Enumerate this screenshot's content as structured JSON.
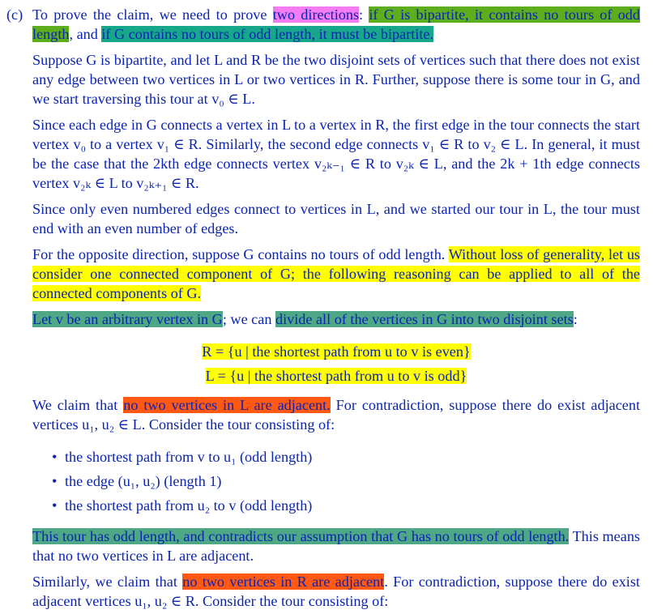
{
  "section_label": "(c)",
  "para1": {
    "t1": "To prove the claim, we need to prove ",
    "h1": "two directions",
    "t2": ": ",
    "h2": "if G is bipartite, it contains no tours of odd length",
    "t3": ", and ",
    "h3": "if G contains no tours of odd length, it must be bipartite."
  },
  "para2": "Suppose G is bipartite, and let L and R be the two disjoint sets of vertices such that there does not exist any edge between two vertices in L or two vertices in R. Further, suppose there is some tour in G, and we start traversing this tour at v₀ ∈ L.",
  "para3": "Since each edge in G connects a vertex in L to a vertex in R, the first edge in the tour connects the start vertex v₀ to a vertex v₁ ∈ R. Similarly, the second edge connects v₁ ∈ R to v₂ ∈ L. In general, it must be the case that the 2kth edge connects vertex v₂ₖ₋₁ ∈ R to v₂ₖ ∈ L, and the 2k + 1th edge connects vertex v₂ₖ ∈ L to v₂ₖ₊₁ ∈ R.",
  "para4": "Since only even numbered edges connect to vertices in L, and we started our tour in L, the tour must end with an even number of edges.",
  "para5": {
    "t1": "For the opposite direction, suppose G contains no tours of odd length. ",
    "h1": "Without loss of generality, let us consider one connected component of G; the following reasoning can be applied to all of the connected components of G."
  },
  "para6": {
    "h1": "Let v be an arbitrary vertex in G",
    "t1": "; we can ",
    "h2": "divide all of the vertices in G into two disjoint sets",
    "t2": ":"
  },
  "eq1": {
    "lhs": "R = {u | ",
    "h": "the shortest path from u to v is even",
    "rhs": "}"
  },
  "eq2": {
    "lhs": "L = {u | ",
    "h": "the shortest path from u to v is odd",
    "rhs": "}"
  },
  "para7": {
    "t1": "We claim that ",
    "h1": "no two vertices in L are adjacent.",
    "t2": " For contradiction, suppose there do exist adjacent vertices u₁, u₂ ∈ L. Consider the tour consisting of:"
  },
  "bullets": [
    "the shortest path from v to u₁ (odd length)",
    "the edge (u₁, u₂) (length 1)",
    "the shortest path from u₂ to v (odd length)"
  ],
  "para8": {
    "h1": "This tour has odd length, and contradicts our assumption that G has no tours of odd length.",
    "t1": "This means that no two vertices in L are adjacent."
  },
  "para9": {
    "t1": "Similarly, we claim that ",
    "h1": "no two vertices in R are adjacent",
    "t2": ". For contradiction, suppose there do exist adjacent vertices u₁, u₂ ∈ R. Consider the tour consisting of:"
  },
  "colors": {
    "text": "#0b24b2",
    "pink": "#f37cf3",
    "green": "#5cae1c",
    "teal": "#17a78a",
    "yellow": "#ffff00",
    "seafoam": "#4ea785",
    "orange": "#fe5813"
  }
}
